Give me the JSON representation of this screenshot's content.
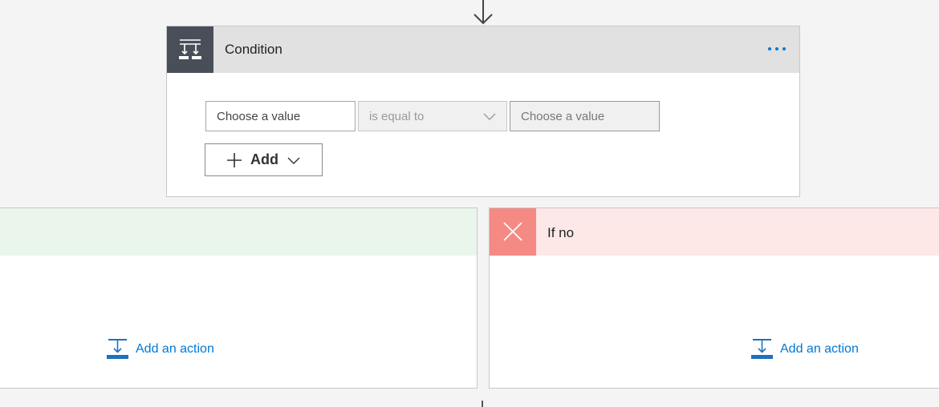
{
  "condition": {
    "title": "Condition",
    "more_label": "...",
    "left_value": {
      "placeholder": "Choose a value"
    },
    "operator": {
      "selected": "is equal to"
    },
    "right_value": {
      "placeholder": "Choose a value"
    },
    "add_button": {
      "label": "Add"
    }
  },
  "branches": {
    "yes": {
      "title": "",
      "add_action_label": "Add an action"
    },
    "no": {
      "title": "If no",
      "add_action_label": "Add an action"
    }
  },
  "colors": {
    "accent": "#0078d4",
    "condition_icon_bg": "#484f58",
    "yes_header_bg": "#eaf6ec",
    "no_header_bg": "#fde7e7",
    "no_icon_bg": "#f58a84"
  },
  "icons": {
    "top_arrow": "arrow-down-icon",
    "condition": "condition-icon",
    "operator_dropdown": "chevron-down-icon",
    "add": "plus-icon",
    "add_dropdown": "chevron-down-icon",
    "no_branch": "close-icon",
    "add_action": "add-action-icon"
  }
}
